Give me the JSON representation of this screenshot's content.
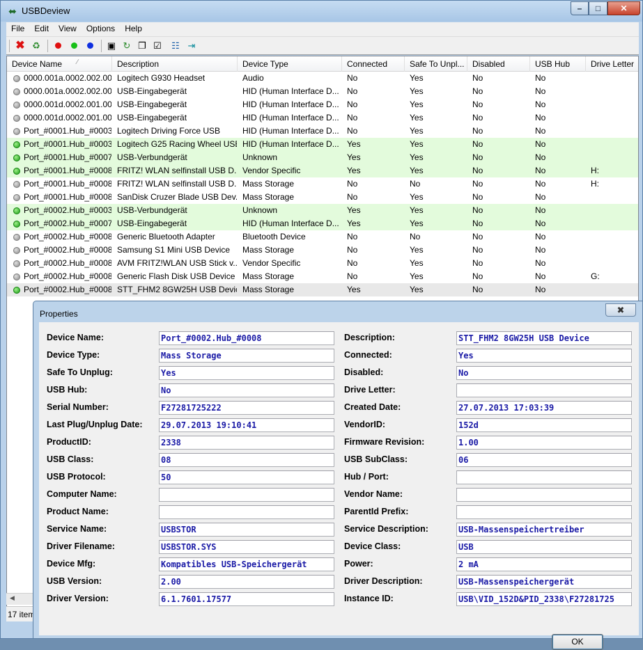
{
  "app": {
    "title": "USBDeview",
    "icon": "usb-plug-icon"
  },
  "menu": [
    "File",
    "Edit",
    "View",
    "Options",
    "Help"
  ],
  "columns": [
    "Device Name",
    "Description",
    "Device Type",
    "Connected",
    "Safe To Unpl...",
    "Disabled",
    "USB Hub",
    "Drive Letter"
  ],
  "rows": [
    {
      "status": "grey",
      "name": "0000.001a.0002.002.00...",
      "desc": "Logitech G930 Headset",
      "type": "Audio",
      "connected": "No",
      "safe": "Yes",
      "disabled": "No",
      "hub": "No",
      "drive": ""
    },
    {
      "status": "grey",
      "name": "0000.001a.0002.002.00...",
      "desc": "USB-Eingabegerät",
      "type": "HID (Human Interface D...",
      "connected": "No",
      "safe": "Yes",
      "disabled": "No",
      "hub": "No",
      "drive": ""
    },
    {
      "status": "grey",
      "name": "0000.001d.0002.001.00...",
      "desc": "USB-Eingabegerät",
      "type": "HID (Human Interface D...",
      "connected": "No",
      "safe": "Yes",
      "disabled": "No",
      "hub": "No",
      "drive": ""
    },
    {
      "status": "grey",
      "name": "0000.001d.0002.001.00...",
      "desc": "USB-Eingabegerät",
      "type": "HID (Human Interface D...",
      "connected": "No",
      "safe": "Yes",
      "disabled": "No",
      "hub": "No",
      "drive": ""
    },
    {
      "status": "grey",
      "name": "Port_#0001.Hub_#0003",
      "desc": "Logitech Driving Force USB",
      "type": "HID (Human Interface D...",
      "connected": "No",
      "safe": "Yes",
      "disabled": "No",
      "hub": "No",
      "drive": ""
    },
    {
      "status": "green",
      "name": "Port_#0001.Hub_#0003",
      "desc": "Logitech G25 Racing Wheel USB",
      "type": "HID (Human Interface D...",
      "connected": "Yes",
      "safe": "Yes",
      "disabled": "No",
      "hub": "No",
      "drive": ""
    },
    {
      "status": "green",
      "name": "Port_#0001.Hub_#0007",
      "desc": "USB-Verbundgerät",
      "type": "Unknown",
      "connected": "Yes",
      "safe": "Yes",
      "disabled": "No",
      "hub": "No",
      "drive": ""
    },
    {
      "status": "green",
      "name": "Port_#0001.Hub_#0008",
      "desc": "FRITZ! WLAN selfinstall USB D...",
      "type": "Vendor Specific",
      "connected": "Yes",
      "safe": "Yes",
      "disabled": "No",
      "hub": "No",
      "drive": "H:"
    },
    {
      "status": "grey",
      "name": "Port_#0001.Hub_#0008",
      "desc": "FRITZ! WLAN selfinstall USB D...",
      "type": "Mass Storage",
      "connected": "No",
      "safe": "No",
      "disabled": "No",
      "hub": "No",
      "drive": "H:"
    },
    {
      "status": "grey",
      "name": "Port_#0001.Hub_#0008",
      "desc": "SanDisk Cruzer Blade USB Dev...",
      "type": "Mass Storage",
      "connected": "No",
      "safe": "Yes",
      "disabled": "No",
      "hub": "No",
      "drive": ""
    },
    {
      "status": "green",
      "name": "Port_#0002.Hub_#0003",
      "desc": "USB-Verbundgerät",
      "type": "Unknown",
      "connected": "Yes",
      "safe": "Yes",
      "disabled": "No",
      "hub": "No",
      "drive": ""
    },
    {
      "status": "green",
      "name": "Port_#0002.Hub_#0007",
      "desc": "USB-Eingabegerät",
      "type": "HID (Human Interface D...",
      "connected": "Yes",
      "safe": "Yes",
      "disabled": "No",
      "hub": "No",
      "drive": ""
    },
    {
      "status": "grey",
      "name": "Port_#0002.Hub_#0008",
      "desc": "Generic Bluetooth Adapter",
      "type": "Bluetooth Device",
      "connected": "No",
      "safe": "No",
      "disabled": "No",
      "hub": "No",
      "drive": ""
    },
    {
      "status": "grey",
      "name": "Port_#0002.Hub_#0008",
      "desc": "Samsung S1 Mini USB Device",
      "type": "Mass Storage",
      "connected": "No",
      "safe": "Yes",
      "disabled": "No",
      "hub": "No",
      "drive": ""
    },
    {
      "status": "grey",
      "name": "Port_#0002.Hub_#0008",
      "desc": "AVM FRITZ!WLAN USB Stick v...",
      "type": "Vendor Specific",
      "connected": "No",
      "safe": "Yes",
      "disabled": "No",
      "hub": "No",
      "drive": ""
    },
    {
      "status": "grey",
      "name": "Port_#0002.Hub_#0008",
      "desc": "Generic Flash Disk USB Device",
      "type": "Mass Storage",
      "connected": "No",
      "safe": "Yes",
      "disabled": "No",
      "hub": "No",
      "drive": "G:"
    },
    {
      "status": "green",
      "name": "Port_#0002.Hub_#0008",
      "desc": "STT_FHM2 8GW25H USB Device",
      "type": "Mass Storage",
      "connected": "Yes",
      "safe": "Yes",
      "disabled": "No",
      "hub": "No",
      "drive": ""
    }
  ],
  "status_bar": "17 item",
  "dialog": {
    "title": "Properties",
    "close_glyph": "✖",
    "ok_label": "OK",
    "left": [
      {
        "label": "Device Name:",
        "value": "Port_#0002.Hub_#0008"
      },
      {
        "label": "Device Type:",
        "value": "Mass Storage"
      },
      {
        "label": "Safe To Unplug:",
        "value": "Yes"
      },
      {
        "label": "USB Hub:",
        "value": "No"
      },
      {
        "label": "Serial Number:",
        "value": "F27281725222"
      },
      {
        "label": "Last Plug/Unplug Date:",
        "value": "29.07.2013 19:10:41"
      },
      {
        "label": "ProductID:",
        "value": "2338"
      },
      {
        "label": "USB Class:",
        "value": "08"
      },
      {
        "label": "USB Protocol:",
        "value": "50"
      },
      {
        "label": "Computer Name:",
        "value": ""
      },
      {
        "label": "Product Name:",
        "value": ""
      },
      {
        "label": "Service Name:",
        "value": "USBSTOR"
      },
      {
        "label": "Driver Filename:",
        "value": "USBSTOR.SYS"
      },
      {
        "label": "Device Mfg:",
        "value": "Kompatibles USB-Speichergerät"
      },
      {
        "label": "USB Version:",
        "value": "2.00"
      },
      {
        "label": "Driver Version:",
        "value": "6.1.7601.17577"
      }
    ],
    "right": [
      {
        "label": "Description:",
        "value": "STT_FHM2 8GW25H USB Device"
      },
      {
        "label": "Connected:",
        "value": "Yes"
      },
      {
        "label": "Disabled:",
        "value": "No"
      },
      {
        "label": "Drive Letter:",
        "value": ""
      },
      {
        "label": "Created Date:",
        "value": "27.07.2013 17:03:39"
      },
      {
        "label": "VendorID:",
        "value": "152d"
      },
      {
        "label": "Firmware Revision:",
        "value": "1.00"
      },
      {
        "label": "USB SubClass:",
        "value": "06"
      },
      {
        "label": "Hub / Port:",
        "value": ""
      },
      {
        "label": "Vendor Name:",
        "value": ""
      },
      {
        "label": "ParentId Prefix:",
        "value": ""
      },
      {
        "label": "Service Description:",
        "value": "USB-Massenspeichertreiber"
      },
      {
        "label": "Device Class:",
        "value": "USB"
      },
      {
        "label": "Power:",
        "value": "2 mA"
      },
      {
        "label": "Driver Description:",
        "value": "USB-Massenspeichergerät"
      },
      {
        "label": "Instance ID:",
        "value": "USB\\VID_152D&PID_2338\\F27281725"
      }
    ]
  }
}
